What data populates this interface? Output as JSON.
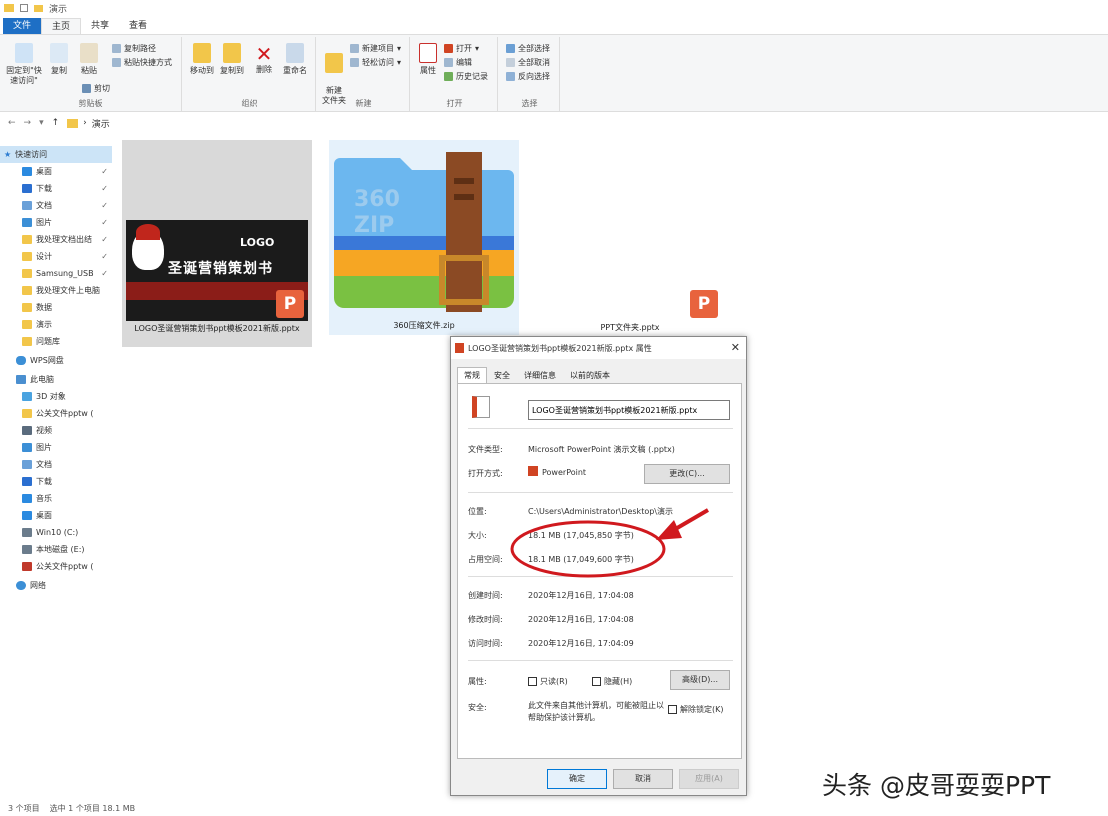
{
  "window": {
    "title": "演示"
  },
  "tabs": [
    {
      "label": "文件"
    },
    {
      "label": "主页"
    },
    {
      "label": "共享"
    },
    {
      "label": "查看"
    }
  ],
  "ribbon": {
    "clipboard": {
      "group": "剪贴板",
      "pin": "固定到\"快速访问\"",
      "copy": "复制",
      "paste": "粘贴",
      "cut": "剪切",
      "copy_path": "复制路径",
      "paste_shortcut": "粘贴快捷方式"
    },
    "organize": {
      "group": "组织",
      "move_to": "移动到",
      "copy_to": "复制到",
      "delete": "删除",
      "rename": "重命名"
    },
    "new": {
      "group": "新建",
      "new_folder": "新建\n文件夹",
      "new_item": "新建项目",
      "easy_access": "轻松访问"
    },
    "open": {
      "group": "打开",
      "properties": "属性",
      "open": "打开",
      "edit": "编辑",
      "history": "历史记录"
    },
    "select": {
      "group": "选择",
      "select_all": "全部选择",
      "select_none": "全部取消",
      "invert": "反向选择"
    }
  },
  "address": {
    "path": "演示"
  },
  "nav": {
    "quick_access": "快速访问",
    "quick_items": [
      {
        "label": "桌面",
        "color": "#2b8ae0"
      },
      {
        "label": "下载",
        "color": "#2b6fd0"
      },
      {
        "label": "文档",
        "color": "#6aa0d8"
      },
      {
        "label": "图片",
        "color": "#3c8fd6"
      },
      {
        "label": "我处理文档出结",
        "color": "#f2c64a"
      },
      {
        "label": "设计",
        "color": "#f2c64a"
      },
      {
        "label": "Samsung_USB",
        "color": "#f2c64a"
      },
      {
        "label": "我处理文件上电脑",
        "color": "#f2c64a"
      },
      {
        "label": "数据",
        "color": "#f2c64a"
      },
      {
        "label": "演示",
        "color": "#f2c64a"
      },
      {
        "label": "问题库",
        "color": "#f2c64a"
      }
    ],
    "wps": "WPS网盘",
    "this_pc": "此电脑",
    "pc_items": [
      {
        "label": "3D 对象",
        "color": "#4aa3e0"
      },
      {
        "label": "公关文件pptw (",
        "color": "#f2c64a"
      },
      {
        "label": "视频",
        "color": "#5a6b7d"
      },
      {
        "label": "图片",
        "color": "#3c8fd6"
      },
      {
        "label": "文档",
        "color": "#6aa0d8"
      },
      {
        "label": "下载",
        "color": "#2b6fd0"
      },
      {
        "label": "音乐",
        "color": "#2b8ae0"
      },
      {
        "label": "桌面",
        "color": "#2b8ae0"
      },
      {
        "label": "Win10 (C:)",
        "color": "#6b7c8c"
      },
      {
        "label": "本地磁盘 (E:)",
        "color": "#6b7c8c"
      },
      {
        "label": "公关文件pptw (",
        "color": "#c0392b"
      }
    ],
    "network": "网络"
  },
  "files": [
    {
      "name": "LOGO圣诞营销策划书ppt模板2021新版.pptx",
      "poster_title": "圣诞营销策划书",
      "poster_logo": "LOGO",
      "badge": "P"
    },
    {
      "name": "360压缩文件.zip",
      "zip_label": "360\nZIP"
    },
    {
      "name": "PPT文件夹.pptx",
      "badge": "P"
    }
  ],
  "dialog": {
    "title": "LOGO圣诞营销策划书ppt模板2021新版.pptx 属性",
    "tabs": [
      "常规",
      "安全",
      "详细信息",
      "以前的版本"
    ],
    "filename": "LOGO圣诞营销策划书ppt模板2021新版.pptx",
    "type_label": "文件类型:",
    "type_value": "Microsoft PowerPoint 演示文稿 (.pptx)",
    "open_label": "打开方式:",
    "open_value": "PowerPoint",
    "change_btn": "更改(C)...",
    "location_label": "位置:",
    "location_value": "C:\\Users\\Administrator\\Desktop\\演示",
    "size_label": "大小:",
    "size_value": "18.1 MB (17,045,850 字节)",
    "disk_label": "占用空间:",
    "disk_value": "18.1 MB (17,049,600 字节)",
    "created_label": "创建时间:",
    "created_value": "2020年12月16日, 17:04:08",
    "modified_label": "修改时间:",
    "modified_value": "2020年12月16日, 17:04:08",
    "accessed_label": "访问时间:",
    "accessed_value": "2020年12月16日, 17:04:09",
    "attr_label": "属性:",
    "readonly": "只读(R)",
    "hidden": "隐藏(H)",
    "advanced_btn": "高级(D)...",
    "security_label": "安全:",
    "security_text": "此文件来自其他计算机，可能被阻止以帮助保护该计算机。",
    "unblock": "解除锁定(K)",
    "ok": "确定",
    "cancel": "取消",
    "apply": "应用(A)"
  },
  "status": {
    "count": "3 个项目",
    "selected": "选中 1 个项目 18.1 MB"
  },
  "watermark": "头条 @皮哥耍耍PPT",
  "colors": {
    "accent": "#1e6fc5",
    "ppt": "#e8633d",
    "annotation": "#d0191e"
  }
}
